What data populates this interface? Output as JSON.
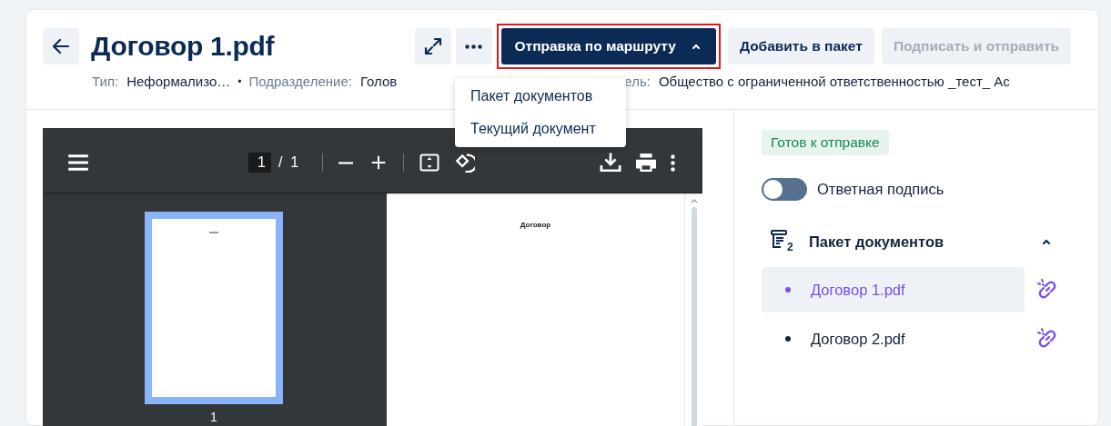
{
  "header": {
    "title": "Договор 1.pdf",
    "actions": [
      {
        "kind": "expand"
      },
      {
        "kind": "more"
      }
    ],
    "route_button": {
      "label": "Отправка по маршруту",
      "expanded": true,
      "highlighted": true
    },
    "buttons": [
      {
        "label": "Добавить в пакет",
        "disabled": false
      },
      {
        "label": "Подписать и отправить",
        "disabled": true
      }
    ],
    "meta_separator": "•",
    "meta": [
      {
        "label": "Тип:",
        "value": "Неформализо…"
      },
      {
        "label": "Подразделение:",
        "value": "Голов"
      },
      {
        "label": "ель:",
        "value": "Общество с ограниченной ответственностью _тест_ Ас"
      }
    ]
  },
  "dropdown": {
    "items": [
      "Пакет документов",
      "Текущий документ"
    ]
  },
  "viewer": {
    "page_input": "1",
    "page_total": "/  1",
    "thumbnails": [
      {
        "number": "1",
        "selected": true
      }
    ],
    "page_heading": "Договор"
  },
  "side": {
    "status": "Готов к отправке",
    "toggle": {
      "label": "Ответная подпись",
      "on": false
    },
    "package": {
      "title": "Пакет документов",
      "count": "2",
      "expanded": true,
      "items": [
        {
          "name": "Договор 1.pdf",
          "selected": true
        },
        {
          "name": "Договор 2.pdf",
          "selected": false
        }
      ]
    }
  }
}
